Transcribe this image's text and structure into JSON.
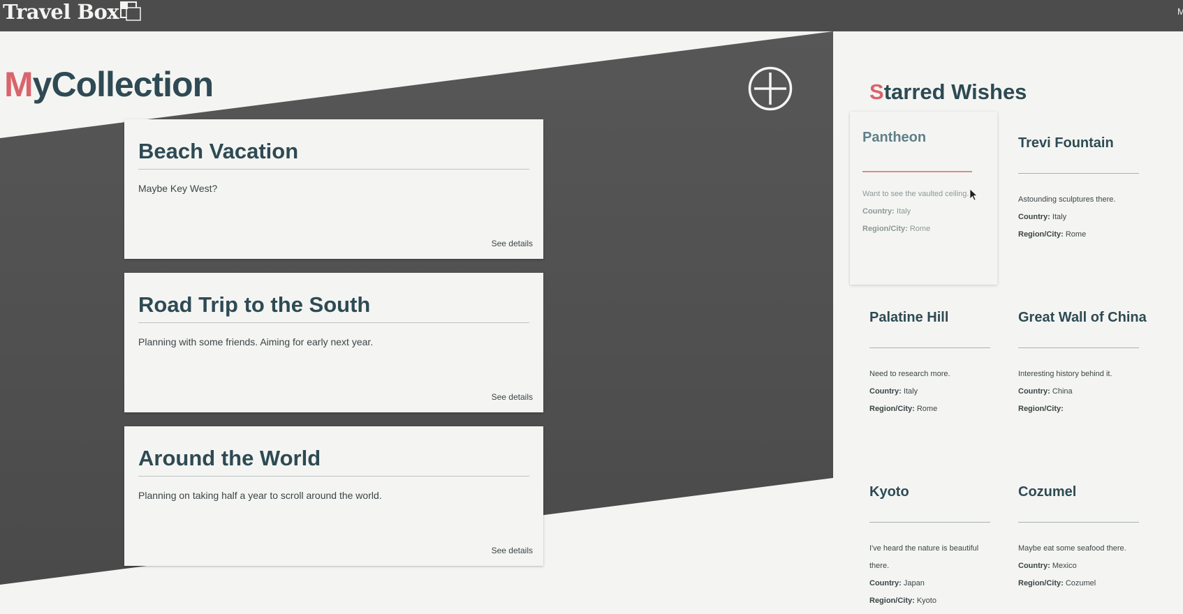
{
  "app": {
    "title": "Travel Box",
    "top_right_text": "M"
  },
  "collection": {
    "heading_first": "M",
    "heading_rest": "yCollection",
    "add_button_icon": "plus-circle-icon",
    "cards": [
      {
        "title": "Beach Vacation",
        "description": "Maybe Key West?",
        "link": "See details"
      },
      {
        "title": "Road Trip to the South",
        "description": "Planning with some friends. Aiming for early next year.",
        "link": "See details"
      },
      {
        "title": "Around the World",
        "description": "Planning on taking half a year to scroll around the world.",
        "link": "See details"
      }
    ]
  },
  "starred": {
    "heading_first": "S",
    "heading_rest": "tarred Wishes",
    "country_label": "Country:",
    "region_label": "Region/City:",
    "wishes": [
      {
        "title": "Pantheon",
        "note": "Want to see the vaulted ceiling.",
        "country": "Italy",
        "region": "Rome"
      },
      {
        "title": "Trevi Fountain",
        "note": "Astounding sculptures there.",
        "country": "Italy",
        "region": "Rome"
      },
      {
        "title": "Palatine Hill",
        "note": "Need to research more.",
        "country": "Italy",
        "region": "Rome"
      },
      {
        "title": "Great Wall of China",
        "note": "Interesting history behind it.",
        "country": "China",
        "region": ""
      },
      {
        "title": "Kyoto",
        "note": "I've heard the nature is beautiful there.",
        "country": "Japan",
        "region": "Kyoto"
      },
      {
        "title": "Cozumel",
        "note": "Maybe eat some seafood there.",
        "country": "Mexico",
        "region": "Cozumel"
      }
    ]
  },
  "colors": {
    "topbar": "#4c4c4c",
    "backdrop": "#505050",
    "page": "#f4f5f2",
    "heading": "#2e4a54",
    "accent": "#d9646c"
  }
}
